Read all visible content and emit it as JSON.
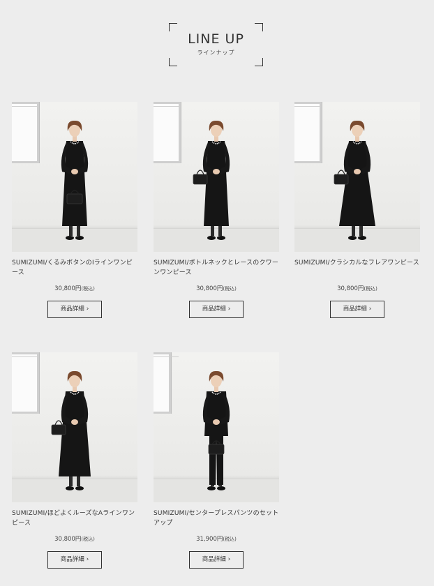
{
  "heading": {
    "title": "LINE UP",
    "subtitle": "ラインナップ"
  },
  "products": [
    {
      "name": "SUMIZUMI/くるみボタンのIラインワンピース",
      "price": "30,800",
      "currency": "円",
      "tax": "(税込)",
      "button": "商品詳細",
      "bag": "front",
      "outfit": "dress-i"
    },
    {
      "name": "SUMIZUMI/ボトルネックとレースのクワーンワンピース",
      "price": "30,800",
      "currency": "円",
      "tax": "(税込)",
      "button": "商品詳細",
      "bag": "side",
      "outfit": "dress-i"
    },
    {
      "name": "SUMIZUMI/クラシカルなフレアワンピース",
      "price": "30,800",
      "currency": "円",
      "tax": "(税込)",
      "button": "商品詳細",
      "bag": "side",
      "outfit": "dress-flare"
    },
    {
      "name": "SUMIZUMI/ほどよくルーズなAラインワンピース",
      "price": "30,800",
      "currency": "円",
      "tax": "(税込)",
      "button": "商品詳細",
      "bag": "side",
      "outfit": "dress-a"
    },
    {
      "name": "SUMIZUMI/センタープレスパンツのセットアップ",
      "price": "31,900",
      "currency": "円",
      "tax": "(税込)",
      "button": "商品詳細",
      "bag": "front",
      "outfit": "pants"
    }
  ]
}
